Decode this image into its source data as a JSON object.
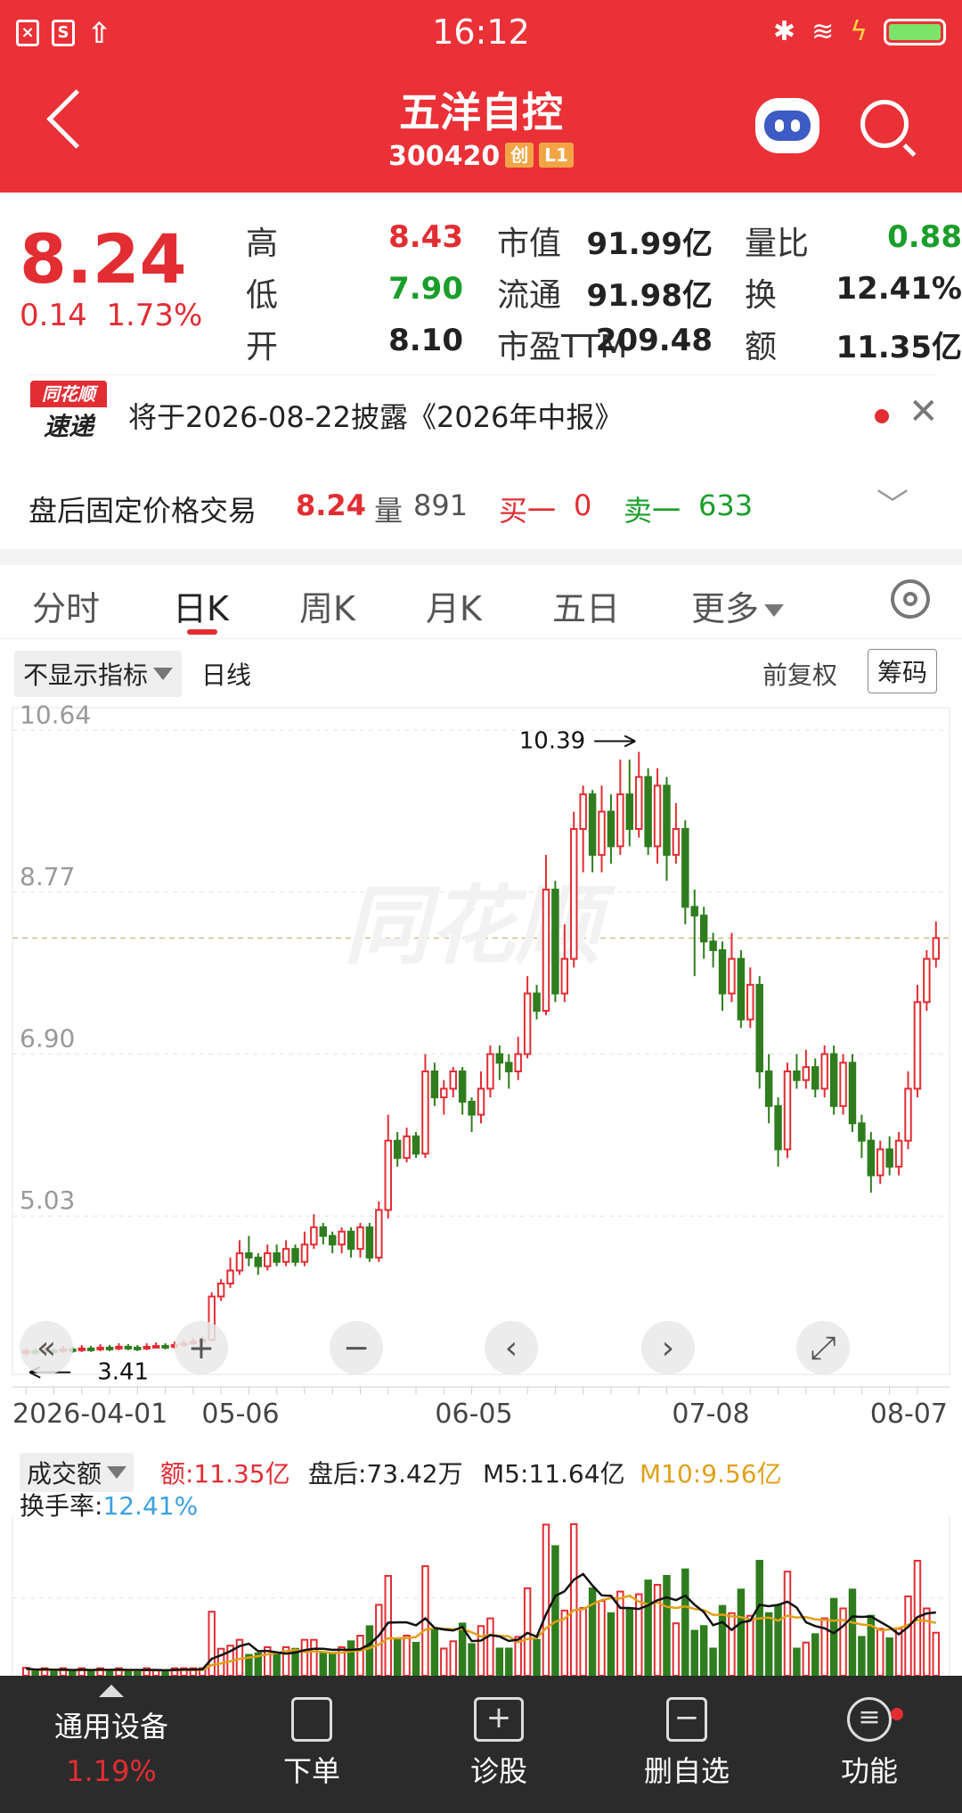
{
  "status_bar": {
    "time": "16:12",
    "left_icons": [
      "close-app-icon",
      "s-app-icon",
      "upload-icon"
    ],
    "right_icons": [
      "bluetooth-icon",
      "wifi-icon",
      "charging-icon",
      "battery-icon"
    ]
  },
  "header": {
    "title": "五洋自控",
    "code": "300420",
    "tag_board": "创",
    "tag_level": "L1"
  },
  "quote": {
    "price": "8.24",
    "change": "0.14",
    "change_pct": "1.73%",
    "stats": [
      {
        "label": "高",
        "value": "8.43",
        "color": "red"
      },
      {
        "label": "低",
        "value": "7.90",
        "color": "green"
      },
      {
        "label": "开",
        "value": "8.10",
        "color": "black"
      },
      {
        "label": "市值",
        "value": "91.99亿",
        "color": "black"
      },
      {
        "label": "流通",
        "value": "91.98亿",
        "color": "black"
      },
      {
        "label": "市盈TTM",
        "value": "209.48",
        "color": "black"
      },
      {
        "label": "量比",
        "value": "0.88",
        "color": "green"
      },
      {
        "label": "换",
        "value": "12.41%",
        "color": "black"
      },
      {
        "label": "额",
        "value": "11.35亿",
        "color": "black"
      }
    ]
  },
  "news": {
    "logo_top": "同花顺",
    "logo_bottom": "速递",
    "text": "将于2026-08-22披露《2026年中报》"
  },
  "after_hours": {
    "label": "盘后固定价格交易",
    "price": "8.24",
    "vol_label": "量",
    "vol": "891",
    "buy_label": "买一",
    "buy": "0",
    "sell_label": "卖一",
    "sell": "633"
  },
  "tabs": [
    "分时",
    "日K",
    "周K",
    "月K",
    "五日",
    "更多"
  ],
  "options": {
    "indicator": "不显示指标",
    "period": "日线",
    "adjust": "前复权",
    "chips": "筹码"
  },
  "chart_data": {
    "type": "candlestick",
    "y_ticks": [
      "10.64",
      "8.77",
      "6.90",
      "5.03"
    ],
    "ylim": [
      3.2,
      10.9
    ],
    "x_ticks": [
      "2026-04-01",
      "05-06",
      "06-05",
      "07-08",
      "08-07"
    ],
    "max_label": "10.39",
    "min_label": "3.41",
    "watermark": "同花顺",
    "candles": [
      [
        3.45,
        3.47,
        3.5,
        3.41
      ],
      [
        3.47,
        3.46,
        3.5,
        3.43
      ],
      [
        3.46,
        3.48,
        3.52,
        3.44
      ],
      [
        3.48,
        3.47,
        3.5,
        3.44
      ],
      [
        3.47,
        3.49,
        3.53,
        3.45
      ],
      [
        3.49,
        3.48,
        3.52,
        3.45
      ],
      [
        3.48,
        3.5,
        3.54,
        3.46
      ],
      [
        3.5,
        3.49,
        3.53,
        3.46
      ],
      [
        3.49,
        3.51,
        3.55,
        3.47
      ],
      [
        3.51,
        3.5,
        3.54,
        3.47
      ],
      [
        3.5,
        3.52,
        3.56,
        3.48
      ],
      [
        3.52,
        3.51,
        3.55,
        3.48
      ],
      [
        3.51,
        3.5,
        3.54,
        3.47
      ],
      [
        3.5,
        3.52,
        3.56,
        3.48
      ],
      [
        3.52,
        3.53,
        3.57,
        3.5
      ],
      [
        3.53,
        3.52,
        3.56,
        3.49
      ],
      [
        3.52,
        3.54,
        3.58,
        3.5
      ],
      [
        3.54,
        3.56,
        3.6,
        3.52
      ],
      [
        3.56,
        3.58,
        3.62,
        3.54
      ],
      [
        3.58,
        3.6,
        3.64,
        3.56
      ],
      [
        3.6,
        4.1,
        4.15,
        3.58
      ],
      [
        4.1,
        4.25,
        4.3,
        4.05
      ],
      [
        4.25,
        4.4,
        4.55,
        4.2
      ],
      [
        4.4,
        4.6,
        4.75,
        4.35
      ],
      [
        4.6,
        4.55,
        4.8,
        4.45
      ],
      [
        4.55,
        4.45,
        4.6,
        4.35
      ],
      [
        4.45,
        4.6,
        4.7,
        4.4
      ],
      [
        4.6,
        4.5,
        4.7,
        4.45
      ],
      [
        4.5,
        4.65,
        4.75,
        4.45
      ],
      [
        4.65,
        4.5,
        4.7,
        4.45
      ],
      [
        4.5,
        4.7,
        4.85,
        4.45
      ],
      [
        4.7,
        4.9,
        5.05,
        4.65
      ],
      [
        4.9,
        4.8,
        4.95,
        4.7
      ],
      [
        4.8,
        4.7,
        4.85,
        4.6
      ],
      [
        4.7,
        4.85,
        4.9,
        4.6
      ],
      [
        4.85,
        4.65,
        4.9,
        4.55
      ],
      [
        4.65,
        4.9,
        4.95,
        4.55
      ],
      [
        4.9,
        4.55,
        4.95,
        4.5
      ],
      [
        4.55,
        5.1,
        5.2,
        4.5
      ],
      [
        5.1,
        5.9,
        6.2,
        5.0
      ],
      [
        5.9,
        5.7,
        6.0,
        5.6
      ],
      [
        5.7,
        5.95,
        6.05,
        5.65
      ],
      [
        5.95,
        5.75,
        6.0,
        5.7
      ],
      [
        5.75,
        6.7,
        6.9,
        5.7
      ],
      [
        6.7,
        6.4,
        6.8,
        6.3
      ],
      [
        6.4,
        6.5,
        6.6,
        6.2
      ],
      [
        6.5,
        6.7,
        6.75,
        6.4
      ],
      [
        6.7,
        6.35,
        6.75,
        6.2
      ],
      [
        6.35,
        6.2,
        6.4,
        6.0
      ],
      [
        6.2,
        6.5,
        6.7,
        6.1
      ],
      [
        6.5,
        6.9,
        7.0,
        6.4
      ],
      [
        6.9,
        6.8,
        7.0,
        6.6
      ],
      [
        6.8,
        6.7,
        6.9,
        6.5
      ],
      [
        6.7,
        6.9,
        7.1,
        6.6
      ],
      [
        6.9,
        7.6,
        7.8,
        6.85
      ],
      [
        7.6,
        7.4,
        7.7,
        7.3
      ],
      [
        7.4,
        8.8,
        9.2,
        7.35
      ],
      [
        8.8,
        7.6,
        8.9,
        7.5
      ],
      [
        7.6,
        8.0,
        8.4,
        7.5
      ],
      [
        8.0,
        9.5,
        9.7,
        7.9
      ],
      [
        9.5,
        9.9,
        10.0,
        9.0
      ],
      [
        9.9,
        9.2,
        9.95,
        9.0
      ],
      [
        9.2,
        9.7,
        10.0,
        9.0
      ],
      [
        9.7,
        9.3,
        9.9,
        9.1
      ],
      [
        9.3,
        9.9,
        10.3,
        9.2
      ],
      [
        9.9,
        9.5,
        10.3,
        9.3
      ],
      [
        9.5,
        10.1,
        10.39,
        9.4
      ],
      [
        10.1,
        9.3,
        10.2,
        9.2
      ],
      [
        9.3,
        10.0,
        10.2,
        9.1
      ],
      [
        10.0,
        9.2,
        10.1,
        8.9
      ],
      [
        9.2,
        9.5,
        9.8,
        9.1
      ],
      [
        9.5,
        8.6,
        9.6,
        8.4
      ],
      [
        8.6,
        8.5,
        8.8,
        7.8
      ],
      [
        8.5,
        8.2,
        8.6,
        8.0
      ],
      [
        8.2,
        8.1,
        8.3,
        7.9
      ],
      [
        8.1,
        7.6,
        8.2,
        7.4
      ],
      [
        7.6,
        8.0,
        8.3,
        7.5
      ],
      [
        8.0,
        7.3,
        8.1,
        7.2
      ],
      [
        7.3,
        7.7,
        7.9,
        7.2
      ],
      [
        7.7,
        6.7,
        7.8,
        6.5
      ],
      [
        6.7,
        6.3,
        6.9,
        6.1
      ],
      [
        6.3,
        5.8,
        6.4,
        5.6
      ],
      [
        5.8,
        6.7,
        6.8,
        5.7
      ],
      [
        6.7,
        6.6,
        6.9,
        6.5
      ],
      [
        6.6,
        6.75,
        6.95,
        6.5
      ],
      [
        6.75,
        6.5,
        6.85,
        6.4
      ],
      [
        6.5,
        6.9,
        7.0,
        6.4
      ],
      [
        6.9,
        6.3,
        7.0,
        6.2
      ],
      [
        6.3,
        6.8,
        6.9,
        6.2
      ],
      [
        6.8,
        6.1,
        6.9,
        6.0
      ],
      [
        6.1,
        5.9,
        6.2,
        5.7
      ],
      [
        5.9,
        5.5,
        6.0,
        5.3
      ],
      [
        5.5,
        5.8,
        5.9,
        5.4
      ],
      [
        5.8,
        5.6,
        5.95,
        5.5
      ],
      [
        5.6,
        5.9,
        6.0,
        5.5
      ],
      [
        5.9,
        6.5,
        6.7,
        5.8
      ],
      [
        6.5,
        7.5,
        7.7,
        6.4
      ],
      [
        7.5,
        8.0,
        8.1,
        7.4
      ],
      [
        8.0,
        8.24,
        8.43,
        7.9
      ]
    ]
  },
  "volume": {
    "selector": "成交额",
    "amount_label": "额:11.35亿",
    "after_label": "盘后:73.42万",
    "m5_label": "M5:11.64亿",
    "m10_label": "M10:9.56亿",
    "turnover_label": "换手率:",
    "turnover_value": "12.41%",
    "colors": {
      "m5": "#111111",
      "m10": "#e0a019",
      "amount": "#e22d33",
      "turnover": "#3aa0e4"
    }
  },
  "bottom_nav": [
    {
      "label": "通用设备",
      "sub": "1.19%",
      "icon": "industry-up-icon"
    },
    {
      "label": "下单",
      "icon": "order-icon"
    },
    {
      "label": "诊股",
      "icon": "diagnose-icon"
    },
    {
      "label": "删自选",
      "icon": "remove-watch-icon"
    },
    {
      "label": "功能",
      "icon": "function-icon"
    }
  ]
}
